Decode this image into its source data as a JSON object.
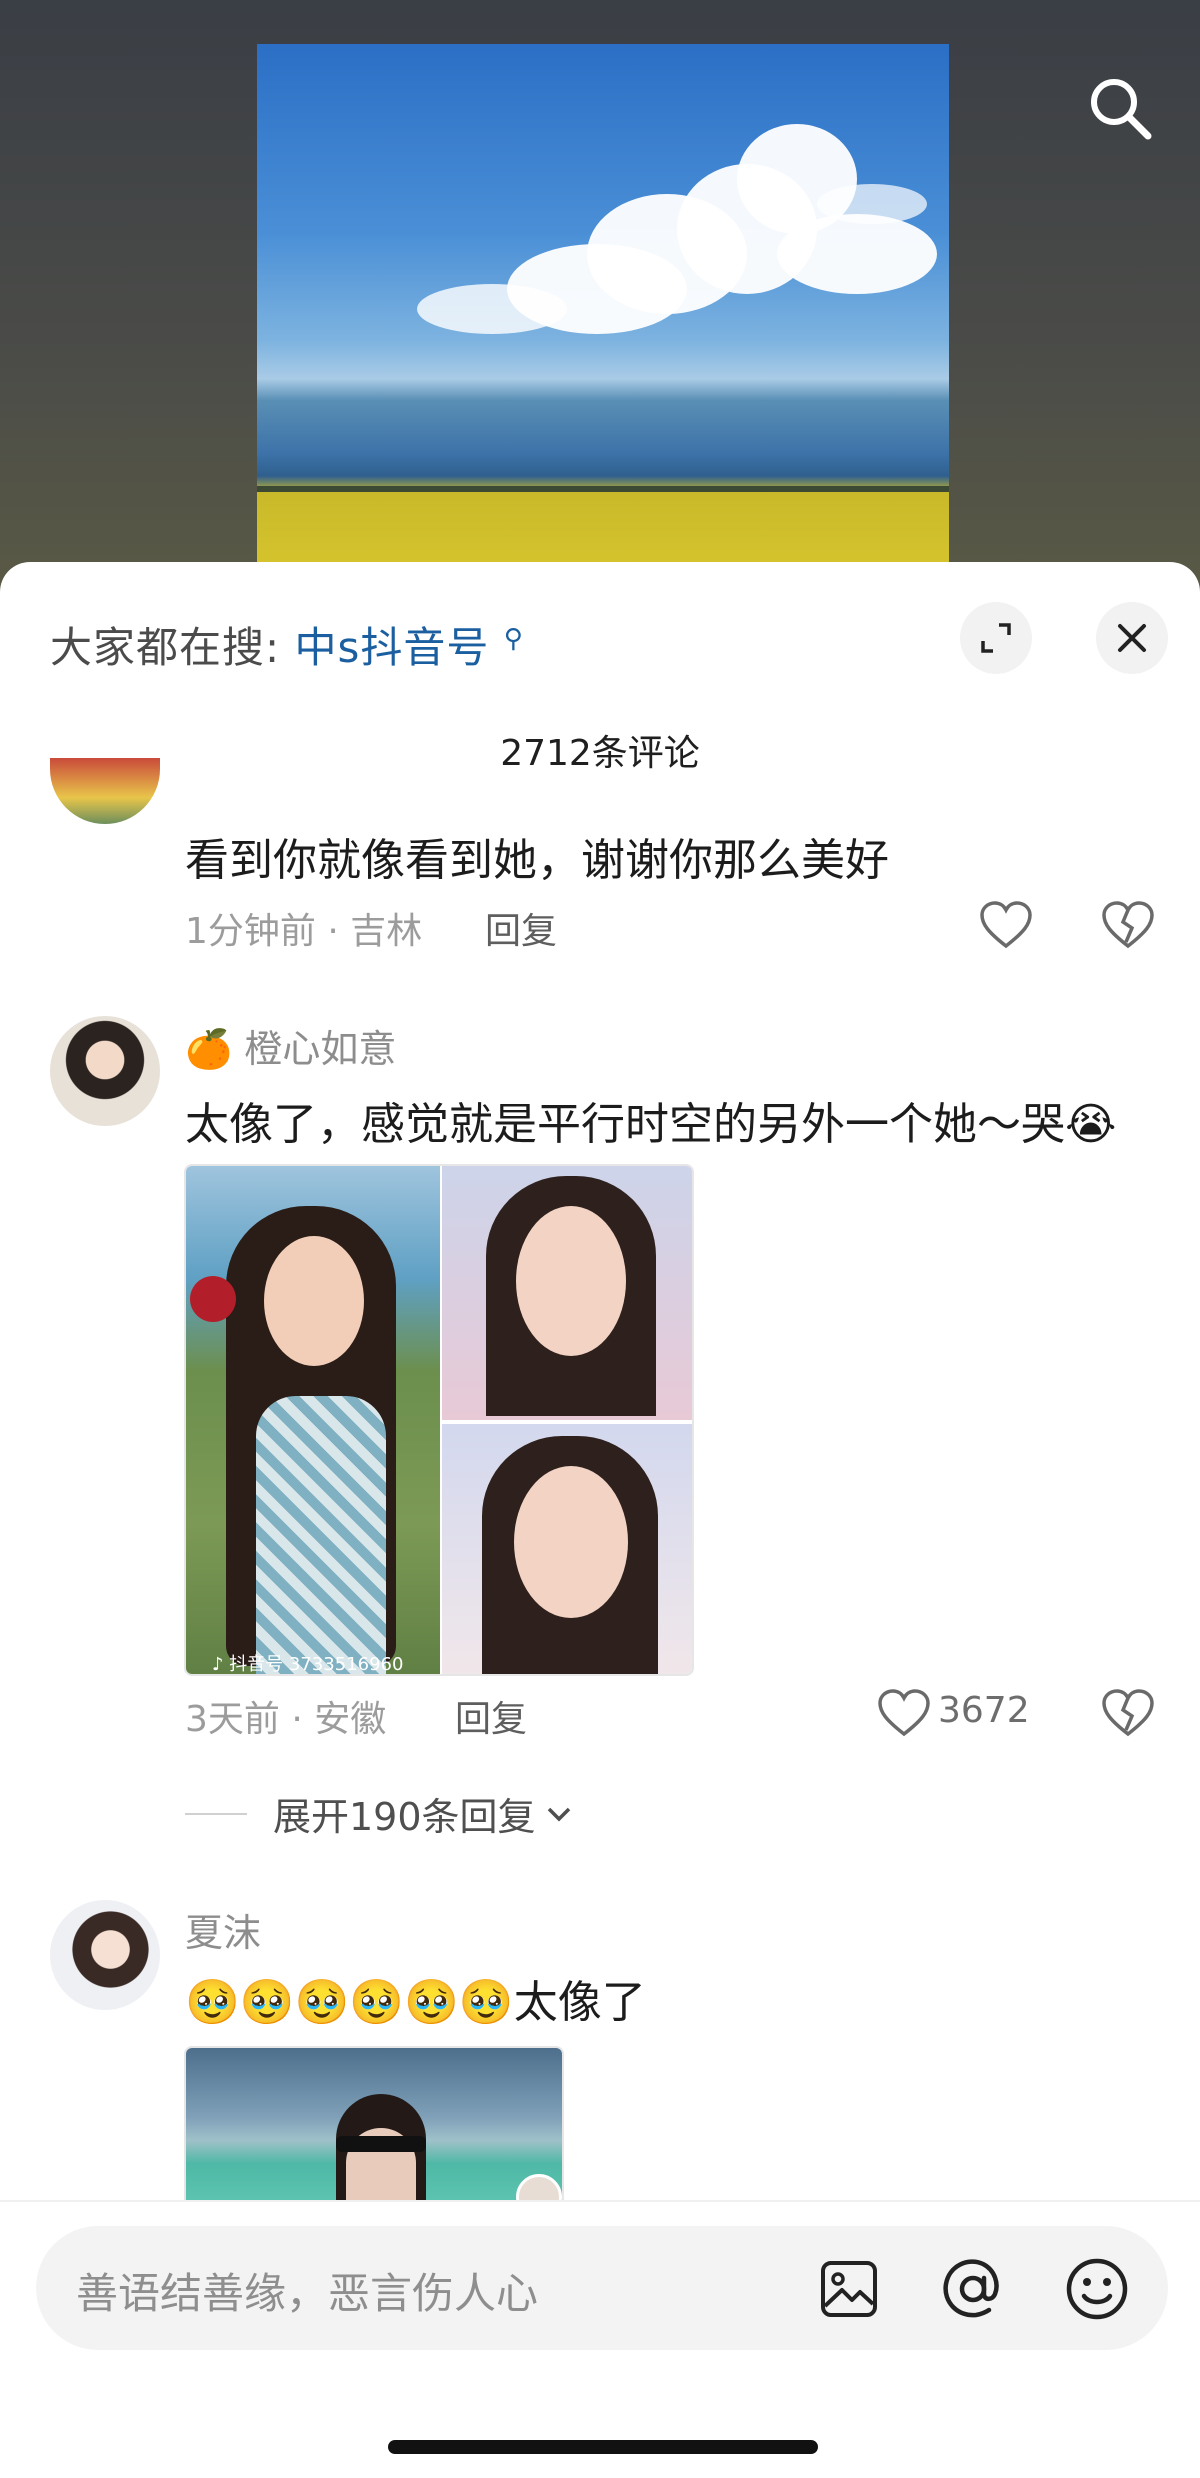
{
  "search": {
    "label": "大家都在搜:",
    "keyword": "中s抖音号"
  },
  "comments_header": {
    "count_text": "2712条评论"
  },
  "comments": [
    {
      "name": "",
      "text": "看到你就像看到她，谢谢你那么美好",
      "meta": "1分钟前 · 吉林",
      "reply_label": "回复",
      "likes": ""
    },
    {
      "name_emoji": "🍊",
      "name": "橙心如意",
      "text": "太像了，感觉就是平行时空的另外一个她～哭😭",
      "photo_watermark": "♪ 抖音号 3733516960",
      "meta": "3天前 · 安徽",
      "reply_label": "回复",
      "likes": "3672",
      "expand_label": "展开190条回复"
    },
    {
      "name": "夏沫",
      "text": "🥹🥹🥹🥹🥹🥹太像了"
    }
  ],
  "input": {
    "placeholder": "善语结善缘，恶言伤人心"
  },
  "icons": {
    "top_search": "search-icon",
    "expand": "expand-icon",
    "close": "close-icon",
    "like": "heart-icon",
    "dislike": "broken-heart-icon",
    "image": "image-icon",
    "mention": "at-icon",
    "emoji": "smile-icon",
    "expand_chevron": "chevron-down-icon"
  },
  "colors": {
    "keyword": "#1b5fa0",
    "sheet_bg": "#ffffff"
  }
}
